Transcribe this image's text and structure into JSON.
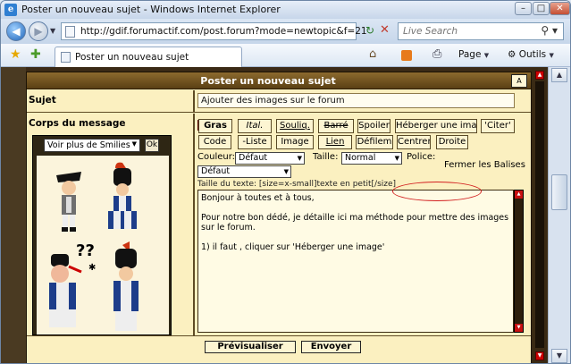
{
  "window": {
    "title": "Poster un nouveau sujet - Windows Internet Explorer",
    "minimize": "–",
    "maximize": "□",
    "close": "✕"
  },
  "address_bar": {
    "url": "http://gdif.forumactif.com/post.forum?mode=newtopic&f=21",
    "search_placeholder": "Live Search"
  },
  "tab": {
    "label": "Poster un nouveau sujet"
  },
  "command_bar": {
    "page_label": "Page",
    "tools_label": "Outils"
  },
  "forum": {
    "header_title": "Poster un nouveau sujet",
    "aa_label": "A",
    "sujet_label": "Sujet",
    "sujet_value": "Ajouter des images sur le forum",
    "corps_label": "Corps du message",
    "smilies_select": "Voir plus de Smilies",
    "smilies_ok": "Ok",
    "toolbar_row1": [
      "Gras",
      "Ital.",
      "Souliq.",
      "Barré",
      "Spoiler",
      "Héberger une ima",
      "'Citer'"
    ],
    "toolbar_row2": [
      "Code",
      "-Liste",
      "Image",
      "Lien",
      "Défilem",
      "Centrer",
      "Droite"
    ],
    "couleur_label": "Couleur:",
    "couleur_value": "Défaut",
    "taille_label": "Taille:",
    "taille_value": "Normal",
    "police_label": "Police:",
    "police_value": "Défaut",
    "fermer_balises": "Fermer les Balises",
    "taille_help": "Taille du texte: [size=x-small]texte en petit[/size]",
    "message": "Bonjour à toutes et à tous,\n\nPour notre bon dédé, je détaille ici ma méthode pour mettre des images sur le forum.\n\n1) il faut , cliquer sur 'Héberger une image'",
    "preview_button": "Prévisualiser",
    "send_button": "Envoyer"
  },
  "colors": {
    "forum_bg": "#fbf0c0",
    "header_bg": "#7a5a24",
    "highlight": "#d21f1f"
  }
}
